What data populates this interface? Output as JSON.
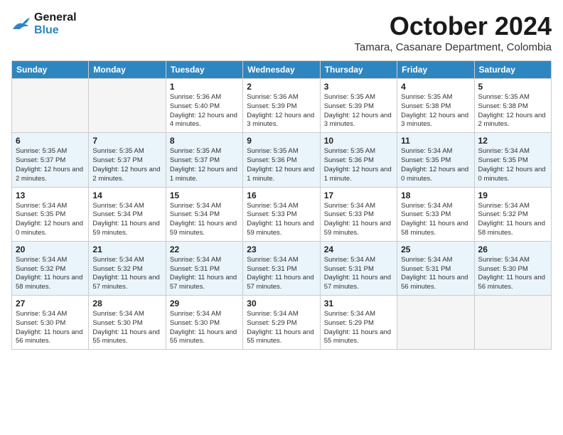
{
  "logo": {
    "text_general": "General",
    "text_blue": "Blue"
  },
  "title": "October 2024",
  "location": "Tamara, Casanare Department, Colombia",
  "days_of_week": [
    "Sunday",
    "Monday",
    "Tuesday",
    "Wednesday",
    "Thursday",
    "Friday",
    "Saturday"
  ],
  "weeks": [
    [
      {
        "day": "",
        "info": ""
      },
      {
        "day": "",
        "info": ""
      },
      {
        "day": "1",
        "info": "Sunrise: 5:36 AM\nSunset: 5:40 PM\nDaylight: 12 hours and 4 minutes."
      },
      {
        "day": "2",
        "info": "Sunrise: 5:36 AM\nSunset: 5:39 PM\nDaylight: 12 hours and 3 minutes."
      },
      {
        "day": "3",
        "info": "Sunrise: 5:35 AM\nSunset: 5:39 PM\nDaylight: 12 hours and 3 minutes."
      },
      {
        "day": "4",
        "info": "Sunrise: 5:35 AM\nSunset: 5:38 PM\nDaylight: 12 hours and 3 minutes."
      },
      {
        "day": "5",
        "info": "Sunrise: 5:35 AM\nSunset: 5:38 PM\nDaylight: 12 hours and 2 minutes."
      }
    ],
    [
      {
        "day": "6",
        "info": "Sunrise: 5:35 AM\nSunset: 5:37 PM\nDaylight: 12 hours and 2 minutes."
      },
      {
        "day": "7",
        "info": "Sunrise: 5:35 AM\nSunset: 5:37 PM\nDaylight: 12 hours and 2 minutes."
      },
      {
        "day": "8",
        "info": "Sunrise: 5:35 AM\nSunset: 5:37 PM\nDaylight: 12 hours and 1 minute."
      },
      {
        "day": "9",
        "info": "Sunrise: 5:35 AM\nSunset: 5:36 PM\nDaylight: 12 hours and 1 minute."
      },
      {
        "day": "10",
        "info": "Sunrise: 5:35 AM\nSunset: 5:36 PM\nDaylight: 12 hours and 1 minute."
      },
      {
        "day": "11",
        "info": "Sunrise: 5:34 AM\nSunset: 5:35 PM\nDaylight: 12 hours and 0 minutes."
      },
      {
        "day": "12",
        "info": "Sunrise: 5:34 AM\nSunset: 5:35 PM\nDaylight: 12 hours and 0 minutes."
      }
    ],
    [
      {
        "day": "13",
        "info": "Sunrise: 5:34 AM\nSunset: 5:35 PM\nDaylight: 12 hours and 0 minutes."
      },
      {
        "day": "14",
        "info": "Sunrise: 5:34 AM\nSunset: 5:34 PM\nDaylight: 11 hours and 59 minutes."
      },
      {
        "day": "15",
        "info": "Sunrise: 5:34 AM\nSunset: 5:34 PM\nDaylight: 11 hours and 59 minutes."
      },
      {
        "day": "16",
        "info": "Sunrise: 5:34 AM\nSunset: 5:33 PM\nDaylight: 11 hours and 59 minutes."
      },
      {
        "day": "17",
        "info": "Sunrise: 5:34 AM\nSunset: 5:33 PM\nDaylight: 11 hours and 59 minutes."
      },
      {
        "day": "18",
        "info": "Sunrise: 5:34 AM\nSunset: 5:33 PM\nDaylight: 11 hours and 58 minutes."
      },
      {
        "day": "19",
        "info": "Sunrise: 5:34 AM\nSunset: 5:32 PM\nDaylight: 11 hours and 58 minutes."
      }
    ],
    [
      {
        "day": "20",
        "info": "Sunrise: 5:34 AM\nSunset: 5:32 PM\nDaylight: 11 hours and 58 minutes."
      },
      {
        "day": "21",
        "info": "Sunrise: 5:34 AM\nSunset: 5:32 PM\nDaylight: 11 hours and 57 minutes."
      },
      {
        "day": "22",
        "info": "Sunrise: 5:34 AM\nSunset: 5:31 PM\nDaylight: 11 hours and 57 minutes."
      },
      {
        "day": "23",
        "info": "Sunrise: 5:34 AM\nSunset: 5:31 PM\nDaylight: 11 hours and 57 minutes."
      },
      {
        "day": "24",
        "info": "Sunrise: 5:34 AM\nSunset: 5:31 PM\nDaylight: 11 hours and 57 minutes."
      },
      {
        "day": "25",
        "info": "Sunrise: 5:34 AM\nSunset: 5:31 PM\nDaylight: 11 hours and 56 minutes."
      },
      {
        "day": "26",
        "info": "Sunrise: 5:34 AM\nSunset: 5:30 PM\nDaylight: 11 hours and 56 minutes."
      }
    ],
    [
      {
        "day": "27",
        "info": "Sunrise: 5:34 AM\nSunset: 5:30 PM\nDaylight: 11 hours and 56 minutes."
      },
      {
        "day": "28",
        "info": "Sunrise: 5:34 AM\nSunset: 5:30 PM\nDaylight: 11 hours and 55 minutes."
      },
      {
        "day": "29",
        "info": "Sunrise: 5:34 AM\nSunset: 5:30 PM\nDaylight: 11 hours and 55 minutes."
      },
      {
        "day": "30",
        "info": "Sunrise: 5:34 AM\nSunset: 5:29 PM\nDaylight: 11 hours and 55 minutes."
      },
      {
        "day": "31",
        "info": "Sunrise: 5:34 AM\nSunset: 5:29 PM\nDaylight: 11 hours and 55 minutes."
      },
      {
        "day": "",
        "info": ""
      },
      {
        "day": "",
        "info": ""
      }
    ]
  ]
}
